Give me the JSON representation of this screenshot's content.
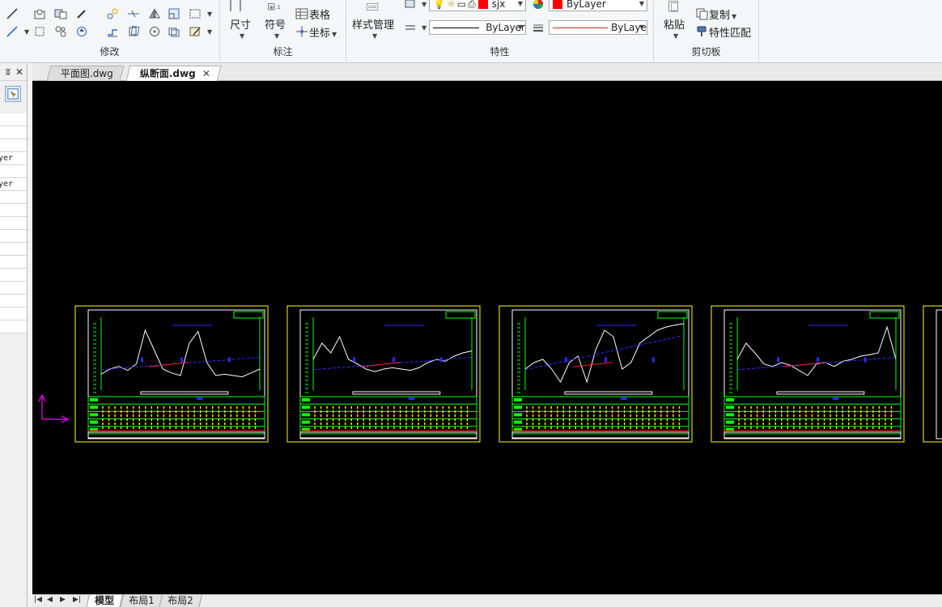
{
  "ribbon": {
    "groups": [
      {
        "title": "修改"
      },
      {
        "title": "标注"
      },
      {
        "title": "特性"
      },
      {
        "title": "剪切板"
      }
    ],
    "dimension_label": "尺寸",
    "symbol_label": "符号",
    "table_label": "表格",
    "coordinate_label": "坐标",
    "style_manager_label": "样式管理",
    "layer_name": "sjx",
    "color_value": "ByLayer",
    "linetype_value": "ByLayer",
    "lineweight_value": "ByLaye",
    "paste_label": "粘贴",
    "copy_label": "复制",
    "match_props_label": "特性匹配"
  },
  "colors": {
    "layer_color": "#ff0000",
    "accent_blue": "#1a5fb4",
    "canvas_bg": "#000000",
    "frame_yellow": "#ffff00",
    "ucs_magenta": "#ff00ff"
  },
  "left_panel": {
    "rows": [
      "",
      "",
      "",
      "ayer",
      "",
      "ayer",
      "",
      "",
      "",
      "",
      "",
      "",
      "",
      "",
      "",
      "",
      ""
    ]
  },
  "tabs": [
    {
      "label": "平面图.dwg",
      "active": false
    },
    {
      "label": "纵断面.dwg",
      "active": true
    }
  ],
  "tab_close_symbol": "✕",
  "layout_tabs": [
    {
      "label": "模型",
      "active": true
    },
    {
      "label": "布局1",
      "active": false
    },
    {
      "label": "布局2",
      "active": false
    }
  ],
  "nav_arrows": [
    "|◀",
    "◀",
    "▶",
    "▶|"
  ],
  "panel_header": {
    "pin": "ʬ",
    "close": "✕"
  }
}
